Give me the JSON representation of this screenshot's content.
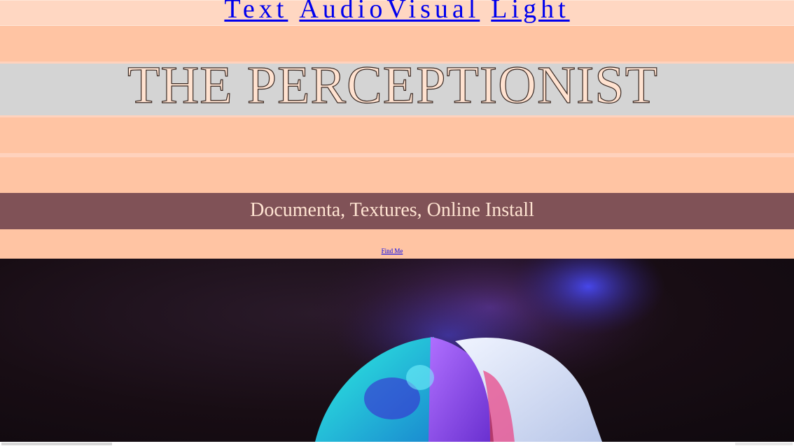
{
  "nav": {
    "links": [
      "Text",
      "AudioVisual",
      "Light"
    ]
  },
  "header": {
    "title": "THE PERCEPTIONIST"
  },
  "subheader": {
    "text": "Documenta, Textures, Online Install"
  },
  "contact": {
    "link_label": "Find Me"
  },
  "colors": {
    "background": "#ffc4a3",
    "nav_background": "#ffd7c2",
    "title_band": "#d4d4d4",
    "subtitle_band": "#805257",
    "link": "#0000ee"
  },
  "image": {
    "description_icon": "photo-image"
  }
}
